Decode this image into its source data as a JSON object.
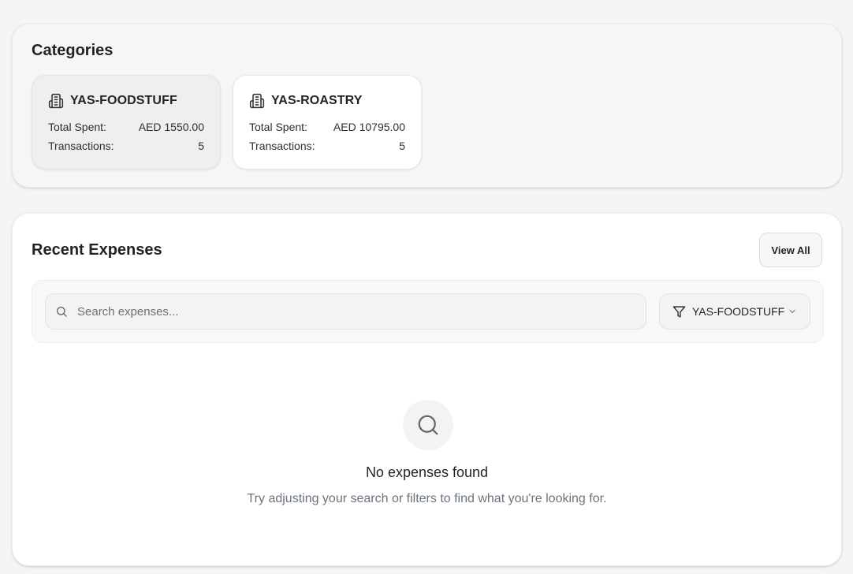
{
  "categories": {
    "title": "Categories",
    "items": [
      {
        "name": "YAS-FOODSTUFF",
        "icon": "building-icon",
        "total_spent_label": "Total Spent:",
        "total_spent_value": "AED 1550.00",
        "transactions_label": "Transactions:",
        "transactions_value": "5",
        "selected": true
      },
      {
        "name": "YAS-ROASTRY",
        "icon": "building-icon",
        "total_spent_label": "Total Spent:",
        "total_spent_value": "AED 10795.00",
        "transactions_label": "Transactions:",
        "transactions_value": "5",
        "selected": false
      }
    ]
  },
  "expenses": {
    "title": "Recent Expenses",
    "view_all_label": "View All",
    "search": {
      "placeholder": "Search expenses...",
      "value": "",
      "icon": "search-icon"
    },
    "filter": {
      "selected": "YAS-FOODSTUFF",
      "icon": "filter-icon"
    },
    "empty": {
      "icon": "search-icon",
      "title": "No expenses found",
      "subtitle": "Try adjusting your search or filters to find what you're looking for."
    }
  },
  "colors": {
    "page_bg": "#f5f5f5",
    "text_primary": "#1f2328",
    "text_muted": "#6b737c",
    "selected_card_bg": "#efefef"
  }
}
